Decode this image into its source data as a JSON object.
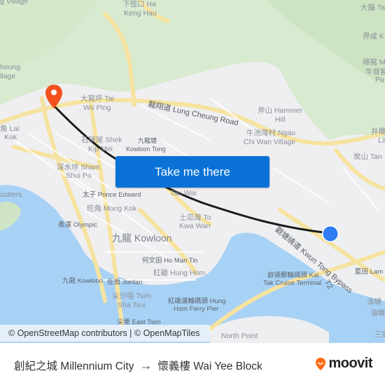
{
  "map": {
    "labels": [
      {
        "text": "下徑口 Ha",
        "kind": "place"
      },
      {
        "text": "Keng Hau",
        "kind": "place"
      },
      {
        "text": "大腦 Ta",
        "kind": "place"
      },
      {
        "text": "界咸 K",
        "kind": "place"
      },
      {
        "text": "嶂窩 M",
        "kind": "place"
      },
      {
        "text": "牛背窩",
        "kind": "place"
      },
      {
        "text": "Pu",
        "kind": "place"
      },
      {
        "text": "井欄",
        "kind": "place"
      },
      {
        "text": "La",
        "kind": "place"
      },
      {
        "text": "炭山 Tan",
        "kind": "place"
      },
      {
        "text": "heung",
        "kind": "place"
      },
      {
        "text": "llage",
        "kind": "place"
      },
      {
        "text": "g Village",
        "kind": "place"
      },
      {
        "text": "大窩坪 Tai",
        "kind": "place"
      },
      {
        "text": "Wo Ping",
        "kind": "place"
      },
      {
        "text": "斧山 Hammer",
        "kind": "place"
      },
      {
        "text": "Hill",
        "kind": "place"
      },
      {
        "text": "牛池灣村 Ngau",
        "kind": "place"
      },
      {
        "text": "Chi Wan Village",
        "kind": "place"
      },
      {
        "text": "角 Lai",
        "kind": "place"
      },
      {
        "text": "Kok",
        "kind": "place"
      },
      {
        "text": "石硤尾 Shek",
        "kind": "place"
      },
      {
        "text": "Kip Mei",
        "kind": "place"
      },
      {
        "text": "九龍塘",
        "kind": "place"
      },
      {
        "text": "Kowloon Tong",
        "kind": "place"
      },
      {
        "text": "深水埗 Sham",
        "kind": "place"
      },
      {
        "text": "Shui Po",
        "kind": "place"
      },
      {
        "text": "cutters",
        "kind": "place"
      },
      {
        "text": "太子 Prince Edward",
        "kind": "station"
      },
      {
        "text": "Tau Wai",
        "kind": "place"
      },
      {
        "text": "旺角 Mong Kok",
        "kind": "place"
      },
      {
        "text": "土瓜灣 To",
        "kind": "place"
      },
      {
        "text": "Kwa Wan",
        "kind": "place"
      },
      {
        "text": "奧運 Olympic",
        "kind": "station"
      },
      {
        "text": "九龍 Kowloon",
        "kind": "district"
      },
      {
        "text": "何文田 Ho Man Tin",
        "kind": "station"
      },
      {
        "text": "紅磡 Hung Hom",
        "kind": "place"
      },
      {
        "text": "九龍 Kowloon",
        "kind": "station"
      },
      {
        "text": "佐敦 Jordan",
        "kind": "station"
      },
      {
        "text": "尖沙咀 Tsim",
        "kind": "place"
      },
      {
        "text": "Sha Tsui",
        "kind": "place"
      },
      {
        "text": "紅磡渡輪碼頭 Hung",
        "kind": "station"
      },
      {
        "text": "Hom Ferry Pier",
        "kind": "station"
      },
      {
        "text": "尖東 East Tsim",
        "kind": "station"
      },
      {
        "text": "啟德郵輪碼頭 Kai",
        "kind": "station"
      },
      {
        "text": "Tak Cruise Terminal",
        "kind": "station"
      },
      {
        "text": "藍田 Lam Ti",
        "kind": "station"
      },
      {
        "text": "油塘",
        "kind": "station"
      },
      {
        "text": "油塘 T",
        "kind": "station"
      },
      {
        "text": "三家",
        "kind": "station"
      },
      {
        "text": "North Point",
        "kind": "place"
      }
    ],
    "road_labels": [
      {
        "text": "龍翔道 Lung Cheung Road"
      },
      {
        "text": "觀塘繞道 Kwun Tong Bypass"
      },
      {
        "text": "T2"
      }
    ],
    "origin_marker": {
      "name": "創紀之城 Millennium City",
      "color": "#f4511e"
    },
    "destination_marker": {
      "name": "懷義樓 Wai Yee Block",
      "color": "#2f7bf2"
    },
    "route_color": "#1a1a1a"
  },
  "cta": {
    "label": "Take me there",
    "color": "#0a72d6"
  },
  "attribution": "© OpenStreetMap contributors | © OpenMapTiles",
  "footer": {
    "origin": "創紀之城 Millennium City",
    "arrow": "→",
    "destination": "懷義樓 Wai Yee Block",
    "brand": "moovit",
    "brand_color": "#ff6a13"
  }
}
